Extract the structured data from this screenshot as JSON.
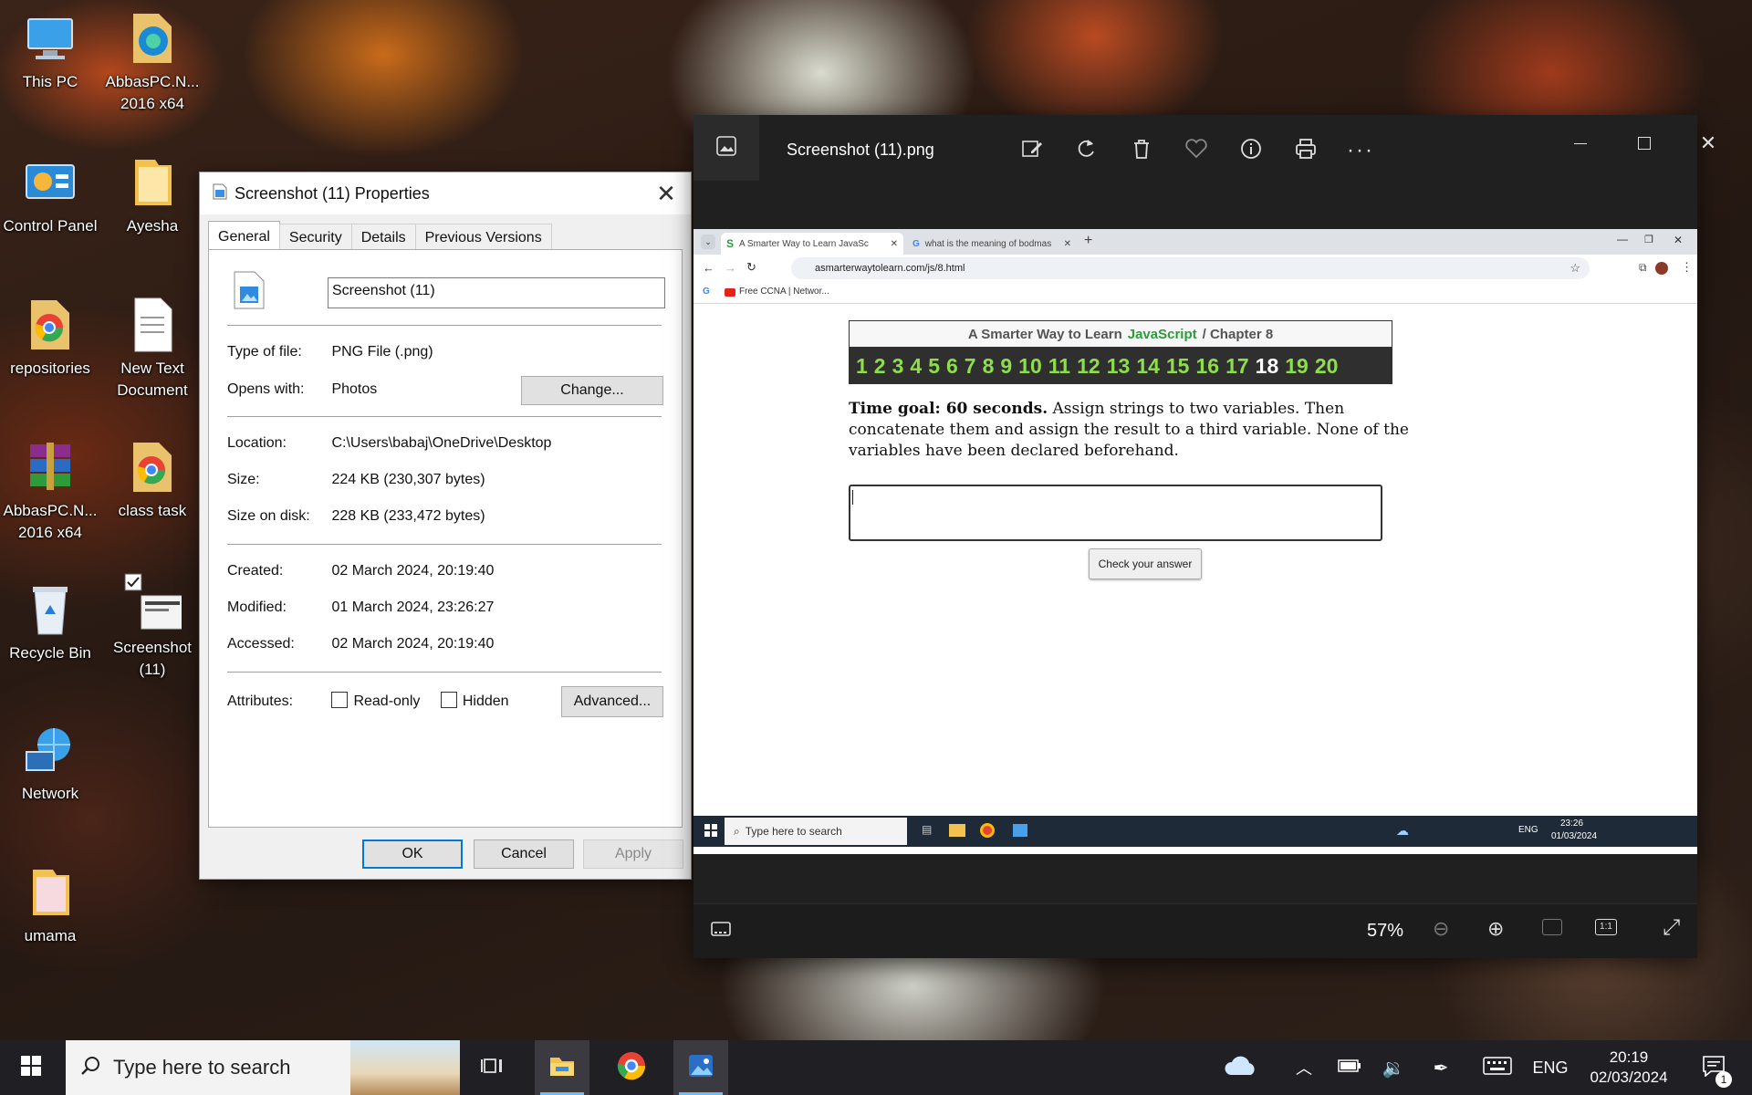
{
  "desktop": {
    "icons": [
      {
        "label": "This PC"
      },
      {
        "label": "AbbasPC.N... 2016 x64"
      },
      {
        "label": "Control Panel"
      },
      {
        "label": "Ayesha"
      },
      {
        "label": "repositories"
      },
      {
        "label": "New Text Document"
      },
      {
        "label": "AbbasPC.N... 2016 x64"
      },
      {
        "label": "class task"
      },
      {
        "label": "Recycle Bin"
      },
      {
        "label": "Screenshot (11)"
      },
      {
        "label": "Network"
      },
      {
        "label": "umama"
      }
    ]
  },
  "properties": {
    "title": "Screenshot (11) Properties",
    "tabs": [
      "General",
      "Security",
      "Details",
      "Previous Versions"
    ],
    "filename": "Screenshot (11)",
    "type_label": "Type of file:",
    "type_value": "PNG File (.png)",
    "opens_label": "Opens with:",
    "opens_value": "Photos",
    "change_button": "Change...",
    "location_label": "Location:",
    "location_value": "C:\\Users\\babaj\\OneDrive\\Desktop",
    "size_label": "Size:",
    "size_value": "224 KB (230,307 bytes)",
    "size_disk_label": "Size on disk:",
    "size_disk_value": "228 KB (233,472 bytes)",
    "created_label": "Created:",
    "created_value": "02 March 2024, 20:19:40",
    "modified_label": "Modified:",
    "modified_value": "01 March 2024, 23:26:27",
    "accessed_label": "Accessed:",
    "accessed_value": "02 March 2024, 20:19:40",
    "attributes_label": "Attributes:",
    "readonly_label": "Read-only",
    "hidden_label": "Hidden",
    "advanced_button": "Advanced...",
    "ok_button": "OK",
    "cancel_button": "Cancel",
    "apply_button": "Apply"
  },
  "photos": {
    "title": "Screenshot (11).png",
    "zoom": "57%",
    "inner": {
      "tab1": "A Smarter Way to Learn JavaSc",
      "tab2": "what is the meaning of bodmas",
      "url": "asmarterwaytolearn.com/js/8.html",
      "bookmark": "Free CCNA | Networ...",
      "header_prefix": "A Smarter Way to Learn",
      "header_js": "JavaScript",
      "header_suffix": "/  Chapter 8",
      "chapters": [
        "1",
        "2",
        "3",
        "4",
        "5",
        "6",
        "7",
        "8",
        "9",
        "10",
        "11",
        "12",
        "13",
        "14",
        "15",
        "16",
        "17",
        "18",
        "19",
        "20"
      ],
      "current_chapter": "18",
      "goal_bold": "Time goal: 60 seconds.",
      "goal_text": "Assign strings to two variables. Then concatenate them and assign the result to a third variable. None of the variables have been declared beforehand.",
      "check_button": "Check your answer",
      "taskbar_search": "Type here to search",
      "taskbar_lang": "ENG",
      "taskbar_time": "23:26",
      "taskbar_date": "01/03/2024"
    }
  },
  "taskbar": {
    "search_placeholder": "Type here to search",
    "lang": "ENG",
    "time": "20:19",
    "date": "02/03/2024",
    "notification_count": "1"
  }
}
